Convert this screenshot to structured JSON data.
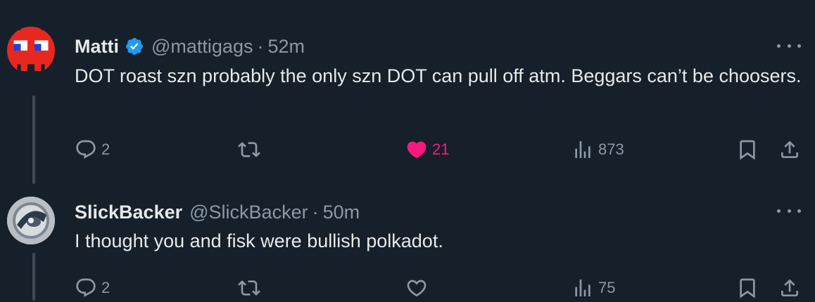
{
  "tweets": [
    {
      "name": "Matti",
      "verified": true,
      "handle": "@mattigags",
      "separator": "·",
      "time": "52m",
      "text": "DOT roast szn probably the only szn DOT can pull off atm. Beggars can’t be choosers.",
      "replies": "2",
      "retweets": "",
      "likes": "21",
      "liked": true,
      "views": "873",
      "avatar_icon": "red-pixel-ghost"
    },
    {
      "name": "SlickBacker",
      "verified": false,
      "handle": "@SlickBacker",
      "separator": "·",
      "time": "50m",
      "text": "I thought you and fisk were bullish polkadot.",
      "replies": "2",
      "retweets": "",
      "likes": "",
      "liked": false,
      "views": "75",
      "avatar_icon": "round-badge-avatar"
    }
  ],
  "colors": {
    "background": "#15202b",
    "text": "#e7e9ea",
    "muted": "#8b98a5",
    "verified": "#1d9bf0",
    "like": "#f91880"
  },
  "icons": [
    "reply-icon",
    "retweet-icon",
    "like-icon",
    "views-icon",
    "bookmark-icon",
    "share-icon",
    "more-icon",
    "verified-badge-icon"
  ]
}
